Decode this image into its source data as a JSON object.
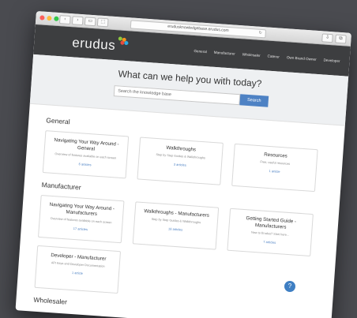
{
  "browser": {
    "url": "erudusknowledgebase.erudus.com",
    "nav_back": "‹",
    "nav_forward": "›"
  },
  "header": {
    "logo_text": "erudus",
    "logo_dot_colors": [
      "#8cc63f",
      "#f7941d",
      "#e84c3d",
      "#29abe2"
    ],
    "nav": [
      "General",
      "Manufacturer",
      "Wholesaler",
      "Caterer",
      "Own Brand Owner",
      "Developer"
    ]
  },
  "hero": {
    "title": "What can we help you with today?",
    "search_placeholder": "Search the knowledge base",
    "search_button": "Search"
  },
  "sections": [
    {
      "title": "General",
      "cards": [
        {
          "title": "Navigating Your Way Around - General",
          "desc": "Overview of features available on each screen",
          "count": "6 articles"
        },
        {
          "title": "Walkthroughs",
          "desc": "Step by Step Guides & Walkthroughs",
          "count": "3 articles"
        },
        {
          "title": "Resources",
          "desc": "Free, useful resources",
          "count": "1 article"
        }
      ]
    },
    {
      "title": "Manufacturer",
      "cards": [
        {
          "title": "Navigating Your Way Around - Manufacturers",
          "desc": "Overview of features available on each screen",
          "count": "17 articles"
        },
        {
          "title": "Walkthroughs - Manufacturers",
          "desc": "Step by Step Guides & Walkthroughs",
          "count": "18 articles"
        },
        {
          "title": "Getting Started Guide - Manufacturers",
          "desc": "New to Erudus? Start here...",
          "count": "7 articles"
        },
        {
          "title": "Developer - Manufacturer",
          "desc": "API Keys and Developer Documentation",
          "count": "1 article"
        }
      ]
    },
    {
      "title": "Wholesaler",
      "cards": []
    }
  ],
  "help_button": "?"
}
